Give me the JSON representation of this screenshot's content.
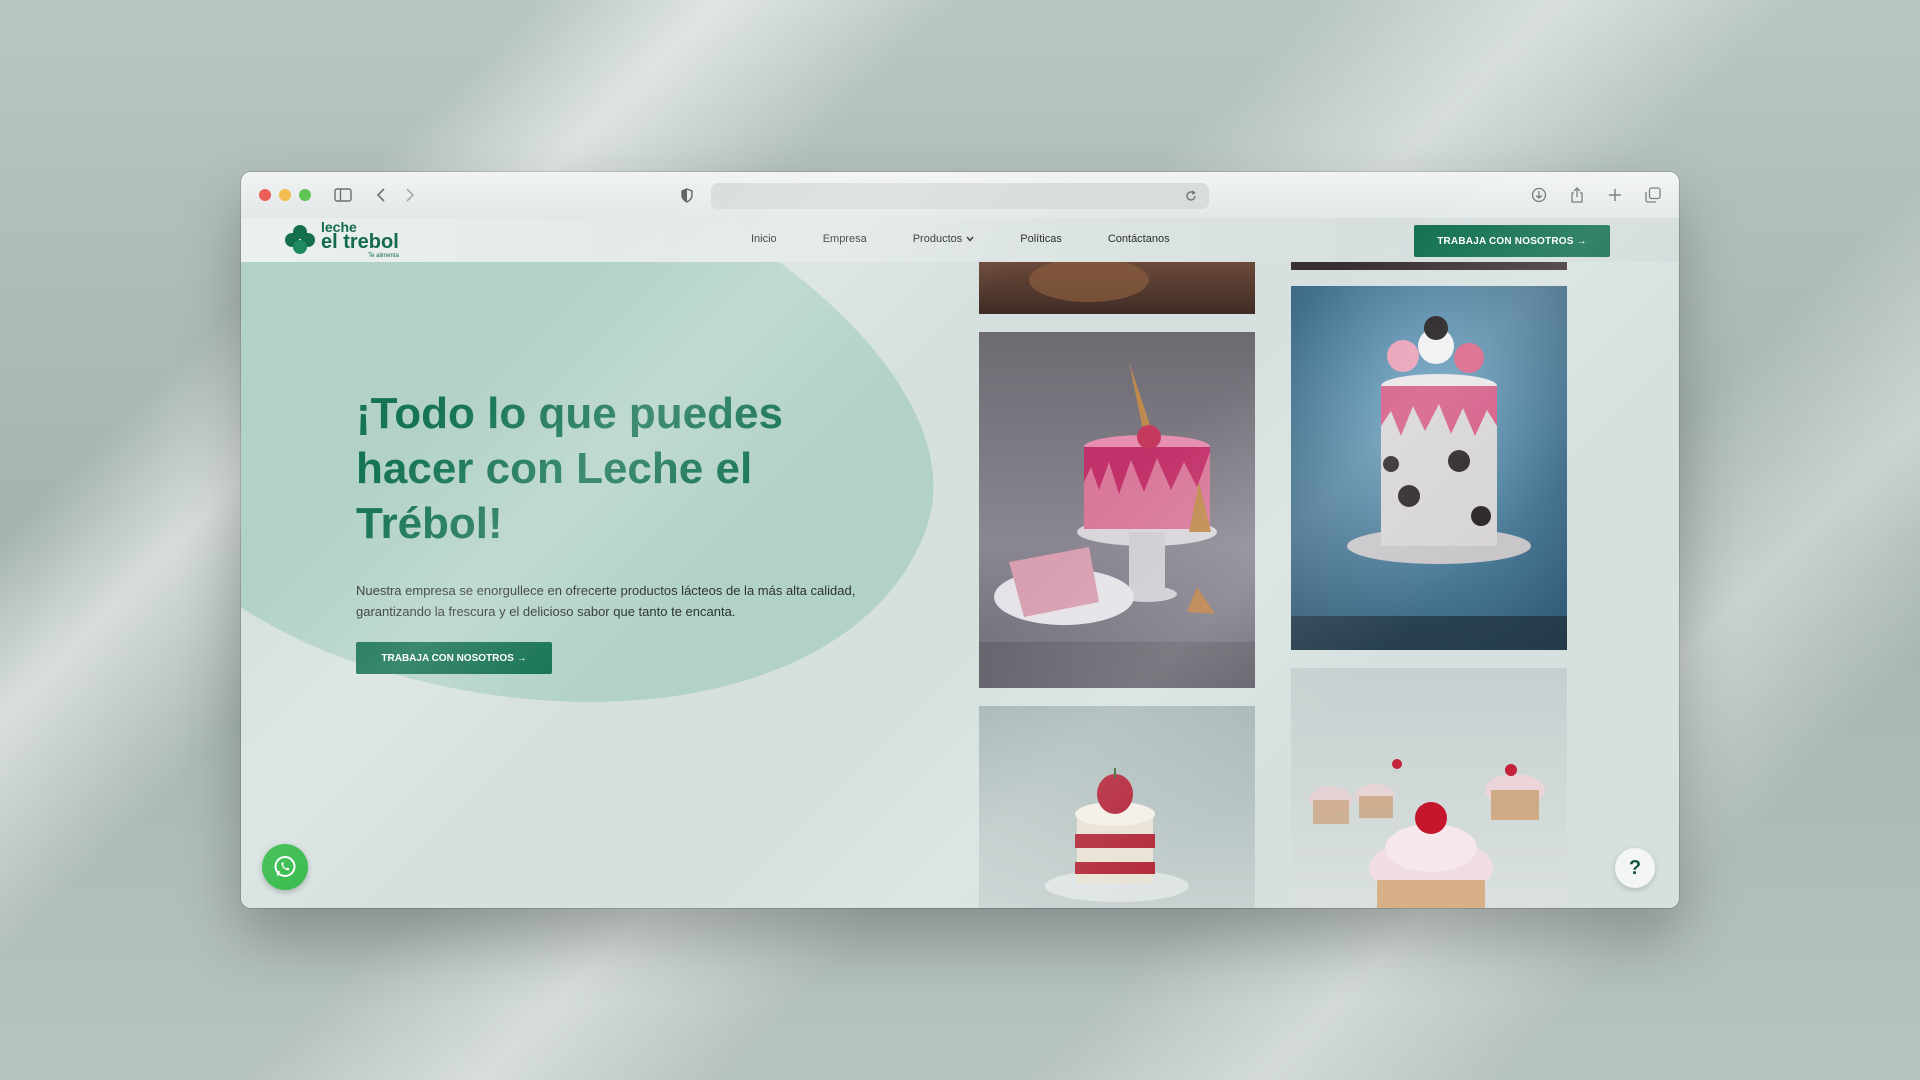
{
  "browser": {
    "icons": [
      "sidebar-icon",
      "back-icon",
      "forward-icon",
      "shield-icon",
      "reload-icon",
      "download-icon",
      "share-icon",
      "new-tab-icon",
      "tabs-overview-icon"
    ]
  },
  "site": {
    "logo": {
      "line1": "leche",
      "line2": "el trebol",
      "tagline": "Te alimenta"
    },
    "nav": [
      {
        "label": "Inicio"
      },
      {
        "label": "Empresa"
      },
      {
        "label": "Productos",
        "has_dropdown": true
      },
      {
        "label": "Políticas"
      },
      {
        "label": "Contáctanos"
      }
    ],
    "header_cta": "TRABAJA CON NOSOTROS →"
  },
  "hero": {
    "title": "¡Todo lo que puedes hacer con Leche el Trébol!",
    "description": "Nuestra empresa se enorgullece en ofrecerte productos lácteos de la más alta calidad, garantizando la frescura y el delicioso sabor que tanto te encanta.",
    "cta": "TRABAJA CON NOSOTROS →"
  },
  "gallery": {
    "photos": [
      "cake-bottom-crop",
      "pink-drip-cake-with-ice-cream-cone",
      "oreo-drip-cake",
      "strawberry-shortcake",
      "cupcakes-with-cherries"
    ]
  },
  "floating": {
    "help_label": "?"
  },
  "colors": {
    "brand_green": "#0f6e4f",
    "title_green": "#157452",
    "whatsapp": "#2bb741"
  }
}
